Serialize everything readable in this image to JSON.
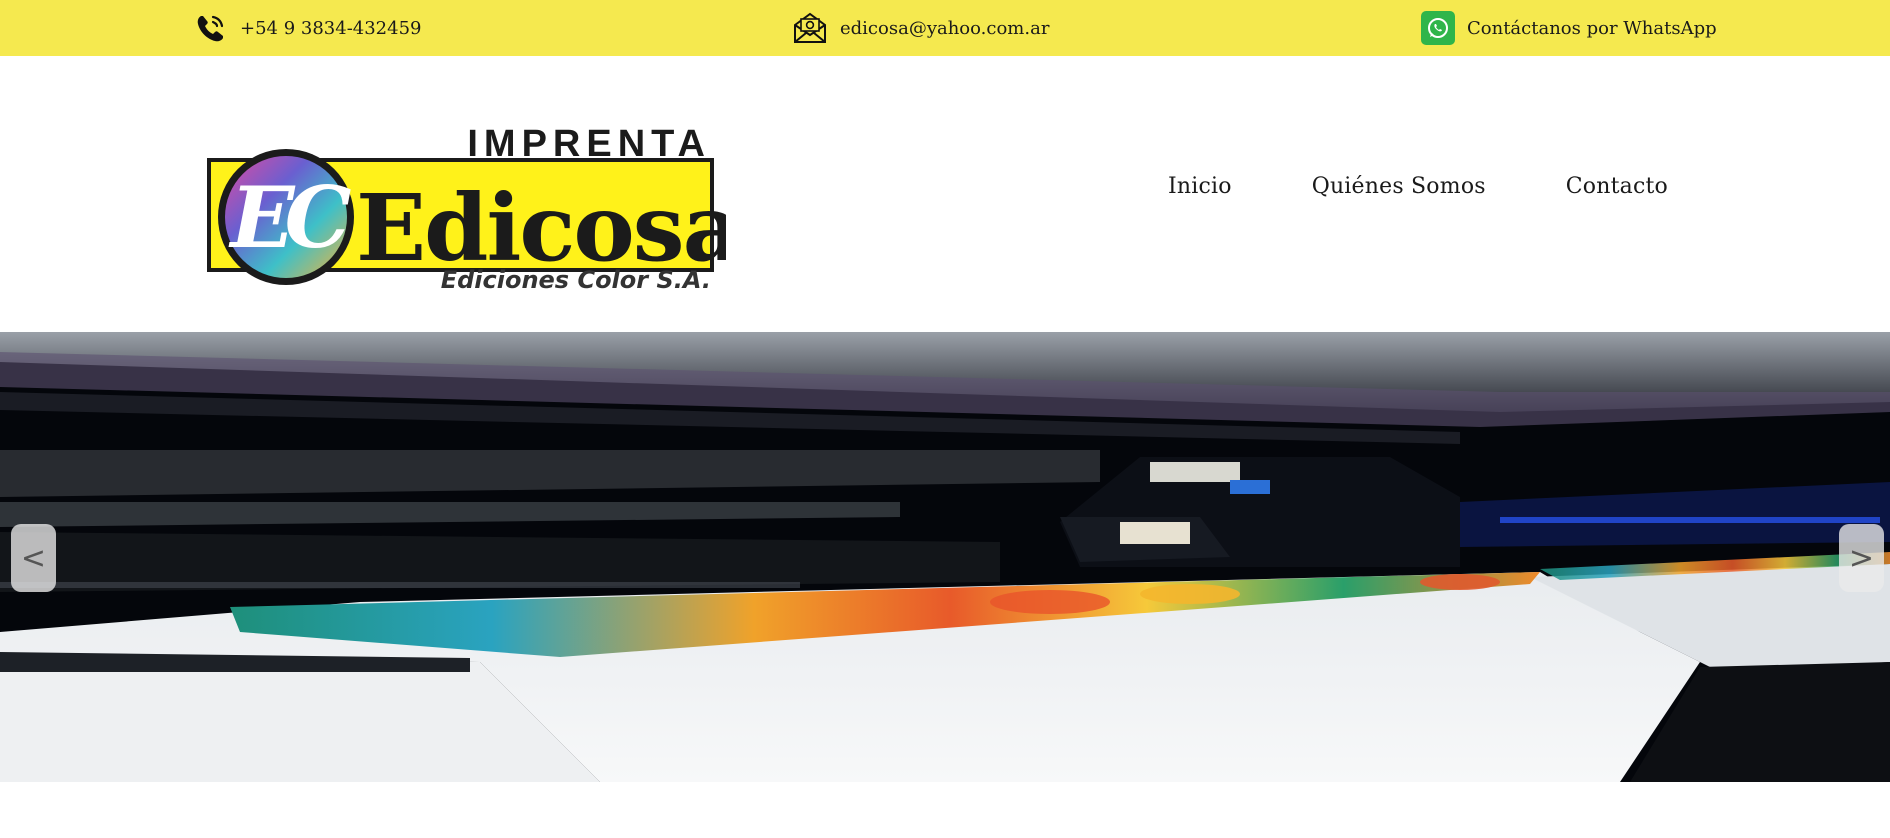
{
  "topbar": {
    "phone": {
      "icon": "phone-icon",
      "text": "+54 9 3834-432459"
    },
    "email": {
      "icon": "envelope-icon",
      "text": "edicosa@yahoo.com.ar"
    },
    "whatsapp": {
      "icon": "whatsapp-icon",
      "text": "Contáctanos por WhatsApp"
    },
    "background_color": "#f5e94f"
  },
  "logo": {
    "top_text": "IMPRENTA",
    "brand": "Edicosa",
    "monogram": "EC",
    "tagline": "Ediciones Color S.A."
  },
  "nav": {
    "items": [
      "Inicio",
      "Quiénes Somos",
      "Contacto"
    ]
  },
  "carousel": {
    "prev_label": "<",
    "next_label": ">",
    "slide": "large-format-printer-photo"
  }
}
